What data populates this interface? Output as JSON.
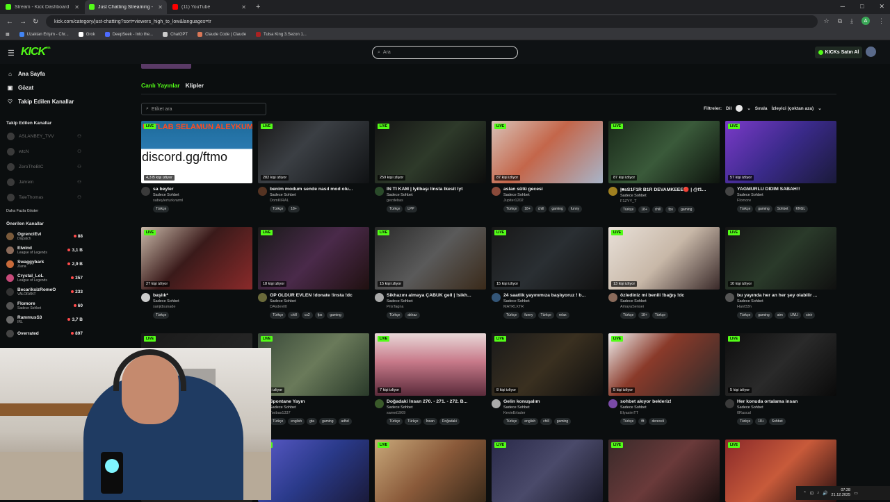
{
  "browser": {
    "tabs": [
      {
        "title": "Stream - Kick Dashboard",
        "color": "#53fc18",
        "active": false
      },
      {
        "title": "Just Chatting Streaming - Live",
        "color": "#53fc18",
        "active": true
      },
      {
        "title": "(11) YouTube",
        "color": "#ff0000",
        "active": false
      }
    ],
    "url": "kick.com/category/just-chatting?sort=viewers_high_to_low&languages=tr",
    "profile_initial": "A",
    "bookmarks": [
      {
        "label": "Uzaktan Erişim - Chr...",
        "color": "#4285f4"
      },
      {
        "label": "Grok",
        "color": "#ffffff"
      },
      {
        "label": "DeepSeek - Into the...",
        "color": "#4d6bfe"
      },
      {
        "label": "ChatGPT",
        "color": "#cccccc"
      },
      {
        "label": "Claude Code | Claude",
        "color": "#d97757"
      },
      {
        "label": "Tulsa King 3.Sezon 1...",
        "color": "#aa2222"
      }
    ]
  },
  "header": {
    "logo": "KICK",
    "logo_beta": "BETA",
    "search_placeholder": "Ara",
    "buy_label": "KICKs Satın Al"
  },
  "sidebar": {
    "nav": [
      {
        "label": "Ana Sayfa",
        "icon": "home-icon",
        "glyph": "⌂"
      },
      {
        "label": "Gözat",
        "icon": "browse-icon",
        "glyph": "▣"
      },
      {
        "label": "Takip Edilen Kanallar",
        "icon": "heart-icon",
        "glyph": "♡"
      }
    ],
    "followed_title": "Takip Edilen Kanallar",
    "followed": [
      {
        "name": "ASLANBEY_TVV",
        "status": "Çevrimdışı"
      },
      {
        "name": "wtcN",
        "status": "Çevrimdışı"
      },
      {
        "name": "ZeroTheBIC",
        "status": "Çevrimdışı"
      },
      {
        "name": "Jahrein",
        "status": "Çevrimdışı"
      },
      {
        "name": "TaleThomas",
        "status": "Çevrimdışı"
      }
    ],
    "show_more": "Daha Fazla Göster",
    "recommended_title": "Önerilen Kanallar",
    "recommended": [
      {
        "name": "OgrenciEvi",
        "category": "Dispatch",
        "viewers": "88",
        "color": "#7a5a3a"
      },
      {
        "name": "Elwind",
        "category": "League of Legends",
        "viewers": "3,1 B",
        "color": "#8a6a5a"
      },
      {
        "name": "Swaggybark",
        "category": "Ziana",
        "viewers": "2,9 B",
        "color": "#c86a3a"
      },
      {
        "name": "Crystal_LoL",
        "category": "League of Legends",
        "viewers": "357",
        "color": "#c84a7a"
      },
      {
        "name": "BecariksizRomeO",
        "category": "VALORANT",
        "viewers": "233",
        "color": "#333333"
      },
      {
        "name": "Flomore",
        "category": "Sadece Sohbet",
        "viewers": "60",
        "color": "#555555"
      },
      {
        "name": "RammusS3",
        "category": "IRL",
        "viewers": "3,7 B",
        "color": "#6a6a6a"
      },
      {
        "name": "Overrated",
        "category": "",
        "viewers": "897",
        "color": "#444444"
      }
    ]
  },
  "main": {
    "tabs": [
      "Canlı Yayınlar",
      "Klipler"
    ],
    "tag_search_placeholder": "Etiket ara",
    "filters_label": "Filtreler:",
    "lang_label": "Dil",
    "lang_count": "1",
    "sort_label": "Sırala",
    "sort_value": "İzleyici (çoktan aza)",
    "live_label": "LIVE",
    "cards": [
      {
        "title": "sa beyler",
        "category": "Sadece Sohbet",
        "streamer": "sabeylerturkvarml",
        "viewers": "4,3 B kişi izliyor",
        "tags": [
          "Türkçe"
        ],
        "bg": "linear-gradient(180deg,#1d6a9a 0%,#2a7ab0 45%,#ffffff 45%,#ffffff 100%)",
        "overlay": "discord.gg/ftmo",
        "overlay_top": "USTLAB SELAMUN ALEYKUM",
        "av": "#3a3a3a"
      },
      {
        "title": "benim modum sende nasıl mod olu...",
        "category": "Sadece Sohbet",
        "streamer": "DomKIRAL",
        "viewers": "282 kişi izliyor",
        "tags": [
          "Türkçe",
          "18+"
        ],
        "bg": "linear-gradient(135deg,#1a1a1a,#3b3f44 40%,#101214)",
        "av": "#553322"
      },
      {
        "title": "İN Tİ KAM | İyilbaşı linsta lkesit lyt",
        "category": "Sadece Sohbet",
        "streamer": "gezdebas",
        "viewers": "259 kişi izliyor",
        "tags": [
          "Türkçe",
          "LPP"
        ],
        "bg": "linear-gradient(135deg,#141414,#2e3a2a 50%,#0d0d0d)",
        "av": "#2a4a2a"
      },
      {
        "title": "aslan sütü gecesi",
        "category": "Sadece Sohbet",
        "streamer": "Jupiter1202",
        "viewers": "87 kişi izliyor",
        "tags": [
          "Türkçe",
          "18+",
          "chill",
          "gaming",
          "funny"
        ],
        "bg": "linear-gradient(135deg,#d8c2b8,#c4664a 45%,#a8b4c8)",
        "av": "#8a4a3a"
      },
      {
        "title": "|■sS1F1R B1R DEVAMKEEE🔴 | @f1...",
        "category": "Sadece Sohbet",
        "streamer": "F1ZYY_T",
        "viewers": "87 kişi izliyor",
        "tags": [
          "Türkçe",
          "18+",
          "chill",
          "fps",
          "gaming"
        ],
        "bg": "linear-gradient(135deg,#1a2a1a,#3a5a3a 50%,#0e140e)",
        "av": "#a08020"
      },
      {
        "title": "YAĞMURLU DİDİM SABAH!!",
        "category": "Sadece Sohbet",
        "streamer": "Flomore",
        "viewers": "57 kişi izliyor",
        "tags": [
          "Türkçe",
          "gaming",
          "Sohbet",
          "KNGL"
        ],
        "bg": "linear-gradient(135deg,#7a3ac8,#3a2a8a 50%,#1a1a3a)",
        "av": "#444444"
      },
      {
        "title": "başlık*",
        "category": "Sadece Sohbet",
        "streamer": "sanjidsunade",
        "viewers": "27 kişi izliyor",
        "tags": [
          "Türkçe"
        ],
        "bg": "linear-gradient(135deg,#c8b8a8,#3a1a1a 45%,#8a2a2a)",
        "av": "#cccccc"
      },
      {
        "title": "ÖP ÖLDÜR EVLEN !donate !insta !dc",
        "category": "Sadece Sohbet",
        "streamer": "DAsdevil0",
        "viewers": "18 kişi izliyor",
        "tags": [
          "Türkçe",
          "chill",
          "cs2",
          "fps",
          "gaming"
        ],
        "bg": "linear-gradient(135deg,#1a1a1a,#4a2a4a 50%,#201010)",
        "av": "#6a6a3a"
      },
      {
        "title": "Sikhazını almaya ÇABUK gell | !sikh...",
        "category": "Sadece Sohbet",
        "streamer": "PrisTagna",
        "viewers": "15 kişi izliyor",
        "tags": [
          "Türkçe",
          "akhaz"
        ],
        "bg": "linear-gradient(135deg,#2a2a2a,#5a5a5a 50%,#3a2a1a)",
        "av": "#aaaaaa"
      },
      {
        "title": "24 saatlik yayınımıza başlıyoruz ! b...",
        "category": "Sadece Sohbet",
        "streamer": "MATR1XTR",
        "viewers": "15 kişi izliyor",
        "tags": [
          "Türkçe",
          "funny",
          "Türkçe",
          "relax"
        ],
        "bg": "linear-gradient(135deg,#181818,#2a2f33 50%,#121212)",
        "av": "#335577"
      },
      {
        "title": "özlediniz mi benili !bağış !dc",
        "category": "Sadece Sohbet",
        "streamer": "AmayaSensei",
        "viewers": "13 kişi izliyor",
        "tags": [
          "Türkçe",
          "18+",
          "Türkçe"
        ],
        "bg": "linear-gradient(135deg,#e8e0d8,#c8b8a8 50%,#3a2a2a)",
        "av": "#8a6a5a"
      },
      {
        "title": "bu yayında her an her şey olabilir ...",
        "category": "Sadece Sohbet",
        "streamer": "Hanf33h",
        "viewers": "10 kişi izliyor",
        "tags": [
          "Türkçe",
          "gaming",
          "aim",
          "LWLI",
          "sinir"
        ],
        "bg": "linear-gradient(135deg,#151515,#2a3a2a 50%,#101010)",
        "av": "#555555"
      },
      {
        "title": "",
        "category": "",
        "streamer": "",
        "viewers": "",
        "tags": [],
        "bg": "linear-gradient(135deg,#1a1a1a,#2a2a2a)",
        "av": "#333333"
      },
      {
        "title": "Spontane Yayın",
        "category": "Sadece Sohbet",
        "streamer": "Toxbas1337",
        "viewers": "7 kişi izliyor",
        "tags": [
          "Türkçe",
          "english",
          "gta",
          "gaming",
          "adhd"
        ],
        "bg": "linear-gradient(135deg,#3a4a3a,#6a7a5a 50%,#2a3a2a)",
        "av": "#444444"
      },
      {
        "title": "Doğadaki İnsan 270. - 271. - 272. B...",
        "category": "Sadece Sohbet",
        "streamer": "samet1909",
        "viewers": "7 kişi izliyor",
        "tags": [
          "Türkçe",
          "Türkçe",
          "İnsan",
          "Doğadaki"
        ],
        "bg": "linear-gradient(180deg,#e8d8d8 0%,#c87a8a 45%,#5a2a3a 100%)",
        "av": "#3a5a2a"
      },
      {
        "title": "Gelin konuşalım",
        "category": "Sadece Sohbet",
        "streamer": "KevinErlader",
        "viewers": "8 kişi izliyor",
        "tags": [
          "Türkçe",
          "english",
          "chill",
          "gaming"
        ],
        "bg": "linear-gradient(135deg,#1a1a1a,#3a3020 50%,#0e0e0e)",
        "av": "#aaaaaa"
      },
      {
        "title": "sohbet akıyor bekleriz!",
        "category": "Sadece Sohbet",
        "streamer": "ElyasimTT",
        "viewers": "5 kişi izliyor",
        "tags": [
          "Türkçe",
          "tft",
          "dereceli"
        ],
        "bg": "linear-gradient(135deg,#f0f0f0,#8a3a2a 40%,#2a2a2a)",
        "av": "#7a4aa8"
      },
      {
        "title": "Her konuda ortalama insan",
        "category": "Sadece Sohbet",
        "streamer": "0Rascal",
        "viewers": "5 kişi izliyor",
        "tags": [
          "Türkçe",
          "18+",
          "Sohbet"
        ],
        "bg": "linear-gradient(135deg,#0e0e0e,#2a2a2a 50%,#0a0a0a)",
        "av": "#3a3a3a"
      },
      {
        "title": "",
        "category": "",
        "streamer": "",
        "viewers": "",
        "tags": [],
        "bg": "linear-gradient(135deg,#1a1a1a,#222)",
        "av": "#333333"
      },
      {
        "title": "",
        "category": "",
        "streamer": "",
        "viewers": "",
        "tags": [],
        "bg": "linear-gradient(135deg,#5a5ac8,#2a3a8a 50%,#1a1a3a)",
        "av": "#333333"
      },
      {
        "title": "",
        "category": "",
        "streamer": "",
        "viewers": "",
        "tags": [],
        "bg": "linear-gradient(135deg,#c8a87a,#8a5a3a 50%,#3a2a1a)",
        "av": "#333333"
      },
      {
        "title": "",
        "category": "",
        "streamer": "",
        "viewers": "",
        "tags": [],
        "bg": "linear-gradient(135deg,#2a2a4a,#4a4a6a 50%,#1a1a2a)",
        "av": "#333333"
      },
      {
        "title": "",
        "category": "",
        "streamer": "",
        "viewers": "",
        "tags": [],
        "bg": "linear-gradient(135deg,#3a2a2a,#6a3a3a 50%,#1a1010)",
        "av": "#333333"
      },
      {
        "title": "",
        "category": "",
        "streamer": "",
        "viewers": "",
        "tags": [],
        "bg": "linear-gradient(135deg,#8a2a2a,#c85a3a 50%,#2a1010)",
        "av": "#333333"
      }
    ]
  },
  "taskbar": {
    "time": "07:28",
    "date": "21.12.2025"
  }
}
